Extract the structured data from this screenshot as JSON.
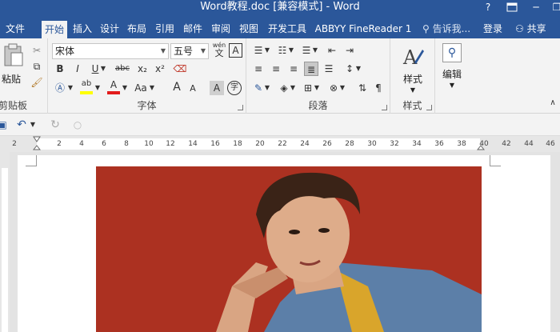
{
  "window": {
    "title": "Word教程.doc [兼容模式] - Word",
    "help": "?",
    "minimize": "─",
    "restore": "❐"
  },
  "tabs": [
    "文件",
    "开始",
    "插入",
    "设计",
    "布局",
    "引用",
    "邮件",
    "审阅",
    "视图",
    "开发工具",
    "ABBYY FineReader 1"
  ],
  "active_tab": "开始",
  "tell_me": "告诉我...",
  "login": "登录",
  "share": "共享",
  "ribbon": {
    "clipboard": {
      "paste_label": "粘贴",
      "group_label": "剪贴板"
    },
    "font": {
      "font_name": "宋体",
      "font_size": "五号",
      "phonetic_top": "wén",
      "phonetic_bottom": "文",
      "border_char": "A",
      "bold": "B",
      "italic": "I",
      "underline": "U",
      "strike": "abc",
      "subscript": "x₂",
      "superscript": "x²",
      "highlight": "ab",
      "font_color": "A",
      "change_case": "Aa",
      "grow": "A",
      "shrink": "A",
      "shading": "A",
      "enclose": "字",
      "group_label": "字体"
    },
    "paragraph": {
      "group_label": "段落"
    },
    "styles": {
      "styles_label": "样式",
      "group_label": "样式"
    },
    "editing": {
      "editing_label": "编辑"
    }
  },
  "ruler_ticks": [
    "2",
    "2",
    "4",
    "6",
    "8",
    "10",
    "12",
    "14",
    "16",
    "18",
    "20",
    "22",
    "24",
    "26",
    "28",
    "30",
    "32",
    "34",
    "36",
    "38",
    "40",
    "42",
    "44",
    "46"
  ],
  "colors": {
    "accent": "#2b579a",
    "highlight": "#ffff00",
    "font_color": "#e21b1b",
    "photo_bg": "#b23524"
  }
}
